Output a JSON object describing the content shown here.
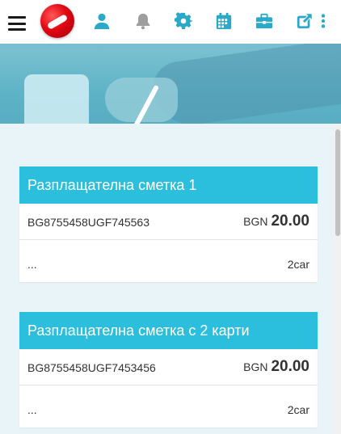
{
  "nav": {
    "menu_icon": "hamburger-icon",
    "logo": "unicredit-logo",
    "icons": [
      "user-icon",
      "bell-icon",
      "gear-icon",
      "calendar-icon",
      "briefcase-icon",
      "external-link-icon",
      "more-vertical-icon"
    ]
  },
  "colors": {
    "accent": "#2bbfdd",
    "icon": "#2ba9c8",
    "bell": "#9e9e9e",
    "logo_red": "#e30613"
  },
  "accounts": [
    {
      "title": "Разплащателна сметка 1",
      "iban": "BG8755458UGF745563",
      "currency": "BGN",
      "balance": "20.00",
      "extra": "...",
      "cards": "2car"
    },
    {
      "title": "Разплащателна сметка с 2 карти",
      "iban": "BG8755458UGF7453456",
      "currency": "BGN",
      "balance": "20.00",
      "extra": "...",
      "cards": "2car"
    }
  ]
}
